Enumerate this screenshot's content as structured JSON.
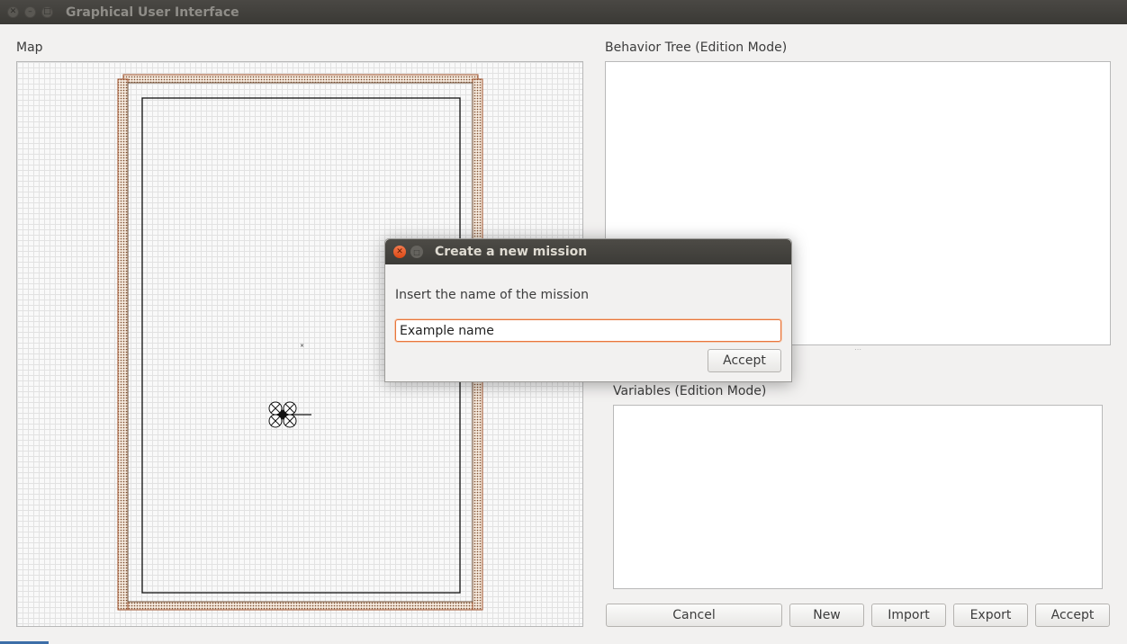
{
  "window": {
    "title": "Graphical User Interface",
    "controls": [
      "close-icon",
      "minimize-icon",
      "maximize-icon"
    ]
  },
  "map": {
    "label": "Map",
    "colors": {
      "grid": "#e2e2e2",
      "wall": "#a0522d",
      "boundary": "#000000"
    }
  },
  "behavior_tree": {
    "label": "Behavior Tree (Edition Mode)"
  },
  "variables": {
    "label": "Variables (Edition Mode)"
  },
  "buttons": {
    "cancel": "Cancel",
    "new": "New",
    "import": "Import",
    "export": "Export",
    "accept": "Accept"
  },
  "dialog": {
    "title": "Create a new mission",
    "prompt": "Insert the name of the mission",
    "input_value": "Example name",
    "accept": "Accept",
    "accent": "#e8753c"
  }
}
